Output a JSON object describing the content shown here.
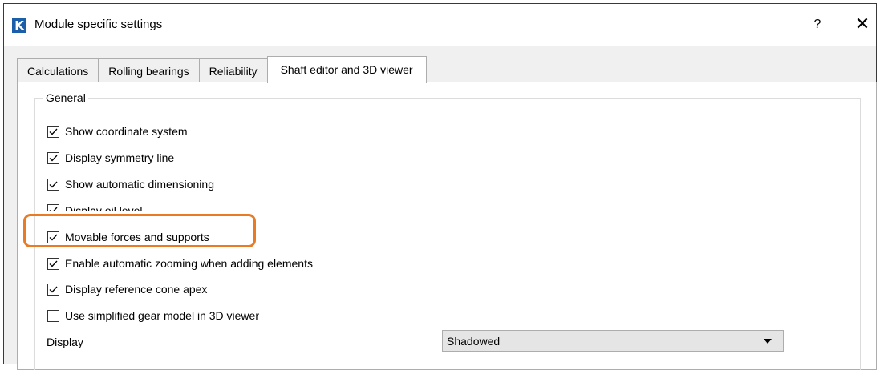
{
  "window": {
    "title": "Module specific settings",
    "app_icon_letter": "K",
    "help_glyph": "?",
    "close_glyph": "✕"
  },
  "tabs": [
    {
      "label": "Calculations",
      "active": false
    },
    {
      "label": "Rolling bearings",
      "active": false
    },
    {
      "label": "Reliability",
      "active": false
    },
    {
      "label": "Shaft editor and 3D viewer",
      "active": true
    }
  ],
  "group": {
    "title": "General",
    "options": [
      {
        "label": "Show coordinate system",
        "checked": true
      },
      {
        "label": "Display symmetry line",
        "checked": true
      },
      {
        "label": "Show automatic dimensioning",
        "checked": true
      },
      {
        "label": "Display oil level",
        "checked": true
      },
      {
        "label": "Movable forces and supports",
        "checked": true,
        "highlighted": true
      },
      {
        "label": "Enable automatic zooming when adding elements",
        "checked": true
      },
      {
        "label": "Display reference cone apex",
        "checked": true
      },
      {
        "label": "Use simplified gear model in 3D viewer",
        "checked": false
      }
    ],
    "display_label": "Display",
    "display_value": "Shadowed"
  },
  "colors": {
    "highlight": "#ea7b25",
    "app_icon": "#1a5fa8"
  }
}
